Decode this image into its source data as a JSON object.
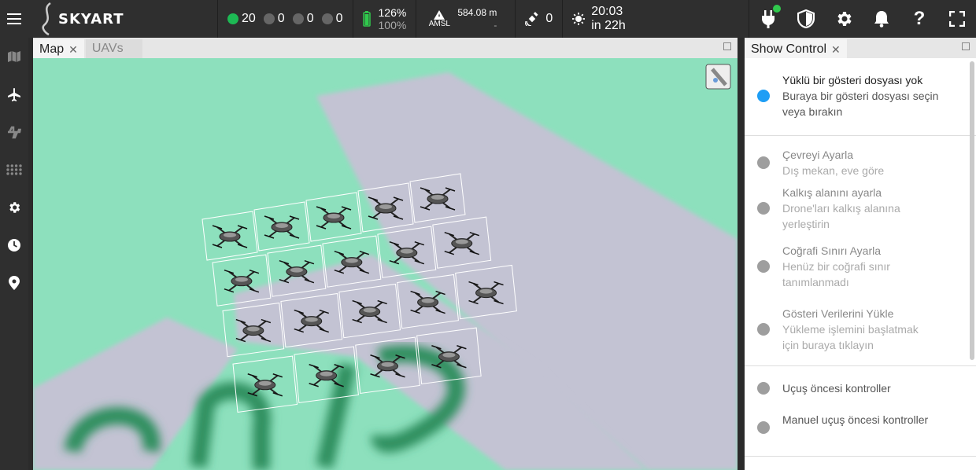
{
  "app": {
    "logo": "SKYART"
  },
  "status": {
    "online": "20",
    "c2": "0",
    "c3": "0",
    "c4": "0",
    "battery_pct": "126%",
    "battery_sub": "100%",
    "altitude": "584.08 m",
    "altitude_ref": "AMSL",
    "altitude_sub": "-",
    "rtk": "0",
    "time": "20:03",
    "time_sub": "in 22h"
  },
  "colors": {
    "online": "#1db954",
    "idle": "#666666",
    "accent": "#1e9ef5",
    "battery": "#30c94d"
  },
  "map_panel": {
    "tabs": [
      {
        "label": "Map",
        "close": "✕"
      },
      {
        "label": "UAVs"
      }
    ]
  },
  "control_panel": {
    "tab": {
      "label": "Show Control",
      "close": "✕"
    },
    "steps": [
      {
        "title": "Yüklü bir gösteri dosyası yok",
        "sub": "Buraya bir gösteri dosyası seçin veya bırakın"
      },
      {
        "title": "Çevreyi Ayarla",
        "sub": "Dış mekan, eve göre"
      },
      {
        "title": "Kalkış alanını ayarla",
        "sub": "Drone'ları kalkış alanına yerleştirin"
      },
      {
        "title": "Coğrafi Sınırı Ayarla",
        "sub": "Henüz bir coğrafi sınır tanımlanmadı"
      },
      {
        "title": "Gösteri Verilerini Yükle",
        "sub": "Yükleme işlemini başlatmak için buraya tıklayın"
      },
      {
        "title": "Uçuş öncesi kontroller"
      },
      {
        "title": "Manuel uçuş öncesi kontroller"
      }
    ]
  }
}
